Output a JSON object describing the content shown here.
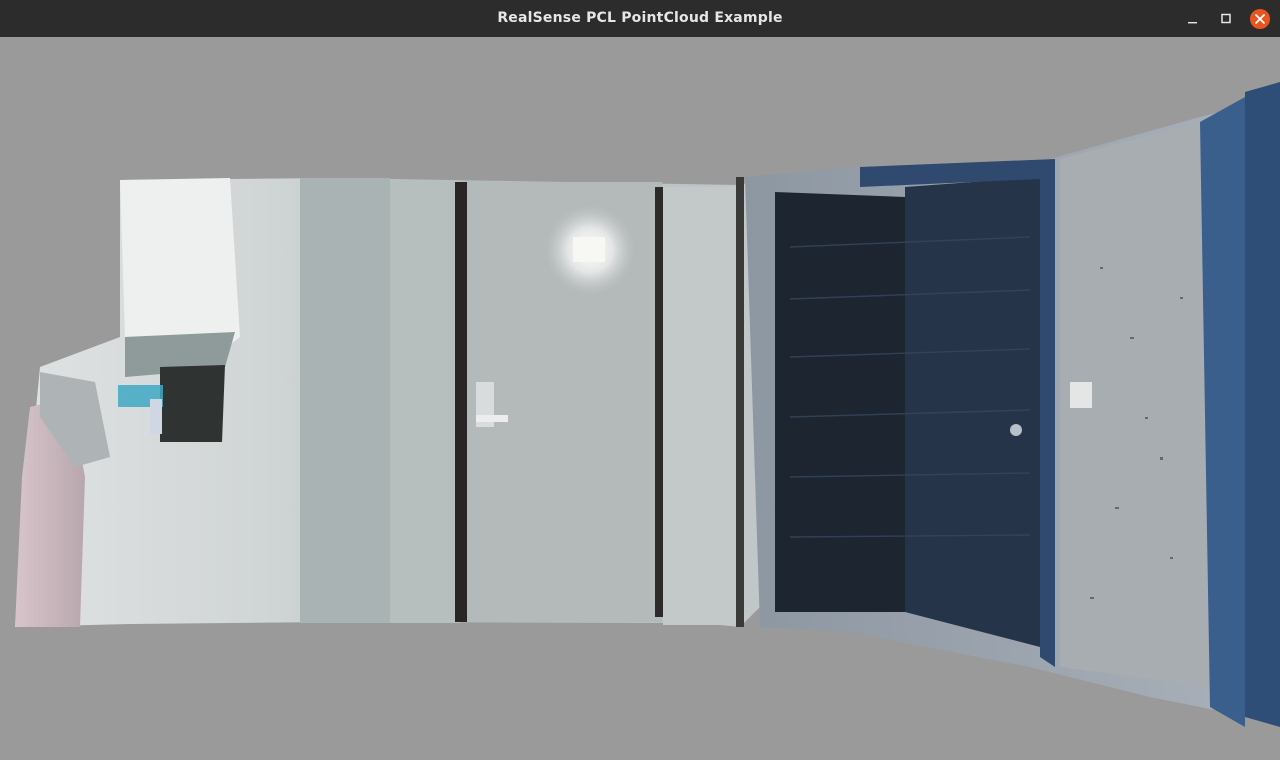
{
  "window": {
    "title": "RealSense PCL PointCloud Example"
  },
  "controls": {
    "minimize_icon": "minimize-icon",
    "maximize_icon": "maximize-icon",
    "close_icon": "close-icon"
  },
  "colors": {
    "titlebar": "#2c2c2c",
    "background": "#9a9a9a",
    "close_button": "#e95420"
  }
}
